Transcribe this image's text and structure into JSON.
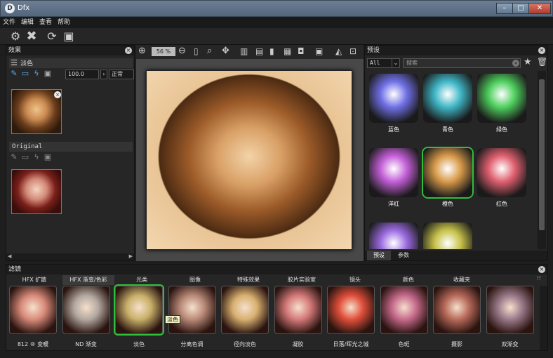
{
  "window": {
    "title": "Dfx",
    "app_icon": "dfx-logo-icon",
    "controls": [
      "minimize",
      "maximize",
      "close"
    ]
  },
  "menu": [
    "文件",
    "编辑",
    "查看",
    "帮助"
  ],
  "toolbar": {
    "icons": [
      "gear-icon",
      "close-icon",
      "refresh-icon",
      "fit-frame-icon"
    ]
  },
  "viewer_toolbar": {
    "zoom": "56 %"
  },
  "effects_panel": {
    "title": "效果",
    "layer1": {
      "name": "淡色",
      "opacity": "100.0",
      "blend": "正常"
    },
    "layer2": {
      "name": "Original"
    }
  },
  "presets_panel": {
    "title": "预设",
    "filter_value": "All",
    "search_placeholder": "搜索",
    "items": [
      {
        "label": "蓝色",
        "color": "#6f6fe6"
      },
      {
        "label": "青色",
        "color": "#3fb6c6"
      },
      {
        "label": "绿色",
        "color": "#4fcf5e"
      },
      {
        "label": "洋红",
        "color": "#c45fd8"
      },
      {
        "label": "橙色",
        "color": "#d89a4a"
      },
      {
        "label": "红色",
        "color": "#e06070"
      },
      {
        "label": "",
        "color": "#9a6adf"
      },
      {
        "label": "",
        "color": "#c7c24a"
      }
    ],
    "tabs": [
      "预设",
      "参数"
    ]
  },
  "filters_panel": {
    "title": "滤镜",
    "tabs": [
      "HFX 扩散",
      "HFX 渐变/色彩",
      "光类",
      "图像",
      "特殊效果",
      "胶片实验室",
      "镜头",
      "颜色",
      "收藏夹"
    ],
    "items": [
      {
        "label": "812 ® 变暖"
      },
      {
        "label": "ND 渐变"
      },
      {
        "label": "淡色"
      },
      {
        "label": "分离色调"
      },
      {
        "label": "径向淡色"
      },
      {
        "label": "凝胶"
      },
      {
        "label": "日落/晖光之城"
      },
      {
        "label": "色斑"
      },
      {
        "label": "摄影"
      },
      {
        "label": "双渐变"
      }
    ],
    "tooltip": "淡色"
  },
  "colors": {
    "accent_selected": "#2fbf3a",
    "panel_bg": "#262626"
  }
}
